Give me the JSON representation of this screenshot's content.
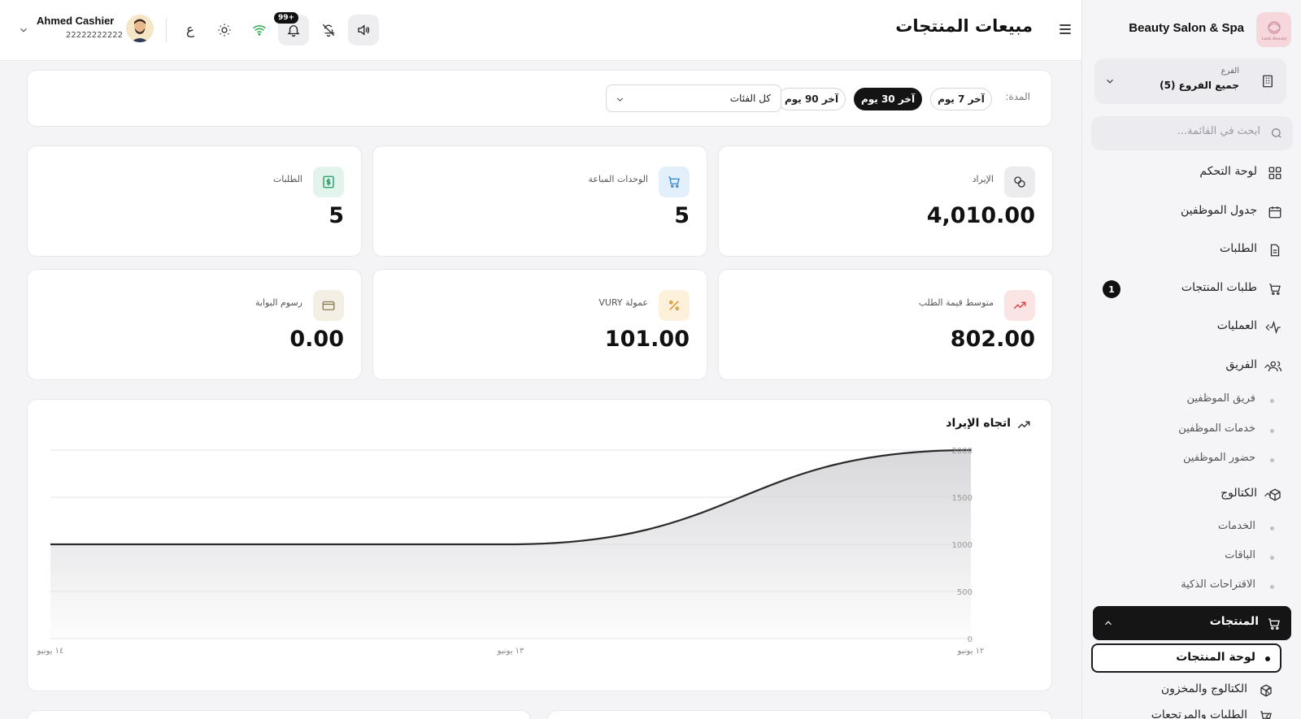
{
  "brand": {
    "name": "Beauty Salon & Spa",
    "logo_text": "Lash Beauty"
  },
  "branch": {
    "label": "الفرع",
    "value": "جميع الفروع (5)"
  },
  "sidebar_search": {
    "placeholder": "ابحث في القائمة..."
  },
  "sidebar": {
    "dashboard": "لوحة التحكم",
    "staff_schedule": "جدول الموظفين",
    "orders": "الطلبات",
    "product_orders": "طلبات المنتجات",
    "product_orders_count": "1",
    "operations": "العمليات",
    "team": "الفريق",
    "team_sub": [
      "فريق الموظفين",
      "خدمات الموظفين",
      "حضور الموظفين"
    ],
    "catalog": "الكتالوج",
    "catalog_sub": [
      "الخدمات",
      "الباقات",
      "الاقتراحات الذكية"
    ],
    "products": "المنتجات",
    "products_dashboard": "لوحة المنتجات",
    "catalog_inventory": "الكتالوج والمخزون",
    "orders_returns": "الطلبات والمرتجعات"
  },
  "header": {
    "title": "مبيعات المنتجات",
    "notif_badge": "+99",
    "lang_toggle": "ع",
    "user_name": "Ahmed Cashier",
    "user_phone": "22222222222"
  },
  "filters": {
    "period_label": "المدة:",
    "periods": [
      "آخر 7 يوم",
      "آخر 30 يوم",
      "آخر 90 يوم"
    ],
    "active_period": "آخر 30 يوم",
    "category_value": "كل الفئات"
  },
  "stats": [
    {
      "label": "الإيراد",
      "value": "4,010.00",
      "icon": "link-icon"
    },
    {
      "label": "الوحدات المباعة",
      "value": "5",
      "icon": "cart-icon"
    },
    {
      "label": "الطلبات",
      "value": "5",
      "icon": "dollar-icon"
    },
    {
      "label": "متوسط قيمة الطلب",
      "value": "802.00",
      "icon": "trend-up-icon"
    },
    {
      "label": "عمولة VURY",
      "value": "101.00",
      "icon": "percent-icon"
    },
    {
      "label": "رسوم البوابة",
      "value": "0.00",
      "icon": "card-icon"
    }
  ],
  "colors": {
    "accent": "#141414",
    "revenue_icon_bg": "#ececee",
    "cart_icon_bg": "#e3f0fb",
    "dollar_icon_bg": "#e2f4ec",
    "trend_icon_bg": "#fbe4e4",
    "percent_icon_bg": "#fdf1dc",
    "card_icon_bg": "#f3efe4"
  },
  "chart_data": {
    "type": "area",
    "title": "اتجاه الإيراد",
    "x": [
      "١٢ يونيو",
      "١٣ يونيو",
      "١٤ يونيو"
    ],
    "series": [
      {
        "values": [
          2000,
          1000,
          1000
        ]
      }
    ],
    "y_ticks": [
      "0",
      "500",
      "1000",
      "1500",
      "2000"
    ],
    "ylim": [
      0,
      2000
    ],
    "grid": true
  }
}
